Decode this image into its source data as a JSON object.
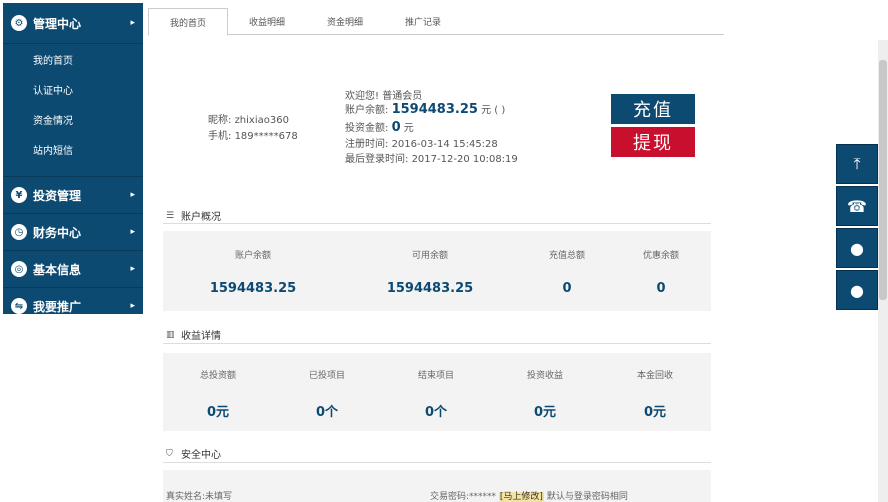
{
  "sidebar": {
    "header": {
      "label": "管理中心",
      "icon": "gear-icon"
    },
    "sub_items": [
      {
        "label": "我的首页"
      },
      {
        "label": "认证中心"
      },
      {
        "label": "资金情况"
      },
      {
        "label": "站内短信"
      }
    ],
    "groups": [
      {
        "label": "投资管理",
        "icon": "user-coin-icon"
      },
      {
        "label": "财务中心",
        "icon": "clock-icon"
      },
      {
        "label": "基本信息",
        "icon": "target-icon"
      },
      {
        "label": "我要推广",
        "icon": "share-icon"
      }
    ]
  },
  "tabs": [
    {
      "label": "我的首页",
      "active": true
    },
    {
      "label": "收益明细"
    },
    {
      "label": "资金明细"
    },
    {
      "label": "推广记录"
    }
  ],
  "profile": {
    "nickname_label": "昵称:",
    "nickname": "zhixiao360",
    "phone_label": "手机:",
    "phone": "189*****678"
  },
  "account_info": {
    "welcome": "欢迎您!",
    "level": "普通会员",
    "balance_label": "账户余额:",
    "balance": "1594483.25",
    "balance_suffix": "元 ( )",
    "invest_label": "投资金额:",
    "invest": "0",
    "invest_suffix": "元",
    "register_label": "注册时间:",
    "register_time": "2016-03-14 15:45:28",
    "lastlogin_label": "最后登录时间:",
    "lastlogin_time": "2017-12-20 10:08:19"
  },
  "actions": {
    "recharge": "充值",
    "withdraw": "提现"
  },
  "overview": {
    "title": "账户概况",
    "items": [
      {
        "label": "账户余额",
        "value": "1594483.25"
      },
      {
        "label": "可用余额",
        "value": "1594483.25"
      },
      {
        "label": "充值总额",
        "value": "0"
      },
      {
        "label": "优惠余额",
        "value": "0"
      }
    ]
  },
  "earnings": {
    "title": "收益详情",
    "items": [
      {
        "label": "总投资额",
        "value": "0元"
      },
      {
        "label": "已投项目",
        "value": "0个"
      },
      {
        "label": "结束项目",
        "value": "0个"
      },
      {
        "label": "投资收益",
        "value": "0元"
      },
      {
        "label": "本金回收",
        "value": "0元"
      }
    ]
  },
  "security": {
    "title": "安全中心",
    "realname": "真实姓名:未填写",
    "trade_pwd_label": "交易密码:******",
    "trade_pwd_action": "[马上修改]",
    "trade_pwd_note": "默认与登录密码相同"
  },
  "float_buttons": [
    {
      "icon": "back-to-top-icon",
      "glyph": "⤒"
    },
    {
      "icon": "phone-icon",
      "glyph": "☎"
    },
    {
      "icon": "qq-icon",
      "glyph": "●"
    },
    {
      "icon": "qq-icon",
      "glyph": "●"
    }
  ],
  "colors": {
    "primary": "#0d4a72",
    "danger": "#c8102e"
  }
}
